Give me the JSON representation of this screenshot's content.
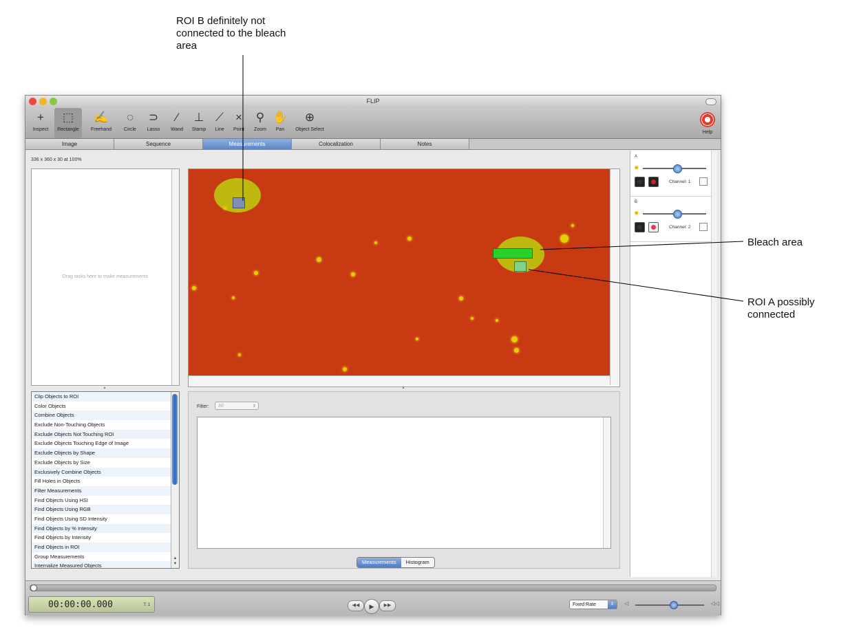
{
  "annotations": {
    "roi_b": [
      "ROI B definitely not",
      "connected to the bleach",
      "area"
    ],
    "bleach": "Bleach area",
    "roi_a": [
      "ROI A possibly",
      "connected"
    ]
  },
  "window": {
    "title": "FLIP"
  },
  "toolbar": {
    "tools": [
      {
        "label": "Inspect",
        "icon": "crosshair-icon",
        "glyph": "+"
      },
      {
        "label": "Rectangle",
        "icon": "rectangle-select-icon",
        "glyph": "⬚"
      },
      {
        "label": "Freehand",
        "icon": "freehand-icon",
        "glyph": "✍"
      },
      {
        "label": "Circle",
        "icon": "circle-select-icon",
        "glyph": "◌"
      },
      {
        "label": "Lasso",
        "icon": "lasso-icon",
        "glyph": "⊃"
      },
      {
        "label": "Wand",
        "icon": "wand-icon",
        "glyph": "⁄"
      },
      {
        "label": "Stamp",
        "icon": "stamp-icon",
        "glyph": "⊥"
      },
      {
        "label": "Line",
        "icon": "line-icon",
        "glyph": "⟋"
      },
      {
        "label": "Point",
        "icon": "point-icon",
        "glyph": "×"
      },
      {
        "label": "Zoom",
        "icon": "zoom-icon",
        "glyph": "⚲"
      },
      {
        "label": "Pan",
        "icon": "hand-icon",
        "glyph": "✋"
      },
      {
        "label": "Object Select",
        "icon": "object-select-icon",
        "glyph": "⊕"
      }
    ],
    "active_tool": "Rectangle",
    "help_label": "Help"
  },
  "tabs": [
    "Image",
    "Sequence",
    "Measurements",
    "Colocalization",
    "Notes"
  ],
  "active_tab": "Measurements",
  "image_info": "336 x 360 x 30 at 100%",
  "task_drop_hint": "Drag tasks here to make measurements",
  "task_list": [
    "Clip Objects to ROI",
    "Color Objects",
    "Combine Objects",
    "Exclude Non-Touching Objects",
    "Exclude Objects Not Touching ROI",
    "Exclude Objects Touching Edge of Image",
    "Exclude Objects by Shape",
    "Exclude Objects by Size",
    "Exclusively Combine Objects",
    "Fill Holes in Objects",
    "Filter Measurements",
    "Find Objects Using HSI",
    "Find Objects Using RGB",
    "Find Objects Using SD Intensity",
    "Find Objects by % Intensity",
    "Find Objects by Intensity",
    "Find Objects in ROI",
    "Group Measurements",
    "Internalize Measured Objects"
  ],
  "filter": {
    "label": "Filter:",
    "value": "All"
  },
  "results_tabs": [
    "Measurements",
    "Histogram"
  ],
  "active_results_tab": "Measurements",
  "channels": [
    {
      "header": "A",
      "label": "Channel: 1",
      "color": "#cc2222"
    },
    {
      "header": "B",
      "label": "Channel: 2",
      "color": "#e03a55"
    }
  ],
  "transport": {
    "timecode": "00:00:00.000",
    "frame": "T: 1",
    "rate": "Fixed Rate"
  },
  "colors": {
    "image_background": "#c83a12",
    "object_yellow": "#e0d000",
    "bleach_green": "#2ad02a",
    "roi_a": "#7fd48a",
    "roi_b": "#7d8fb5",
    "selection_blue": "#5c86c4"
  }
}
